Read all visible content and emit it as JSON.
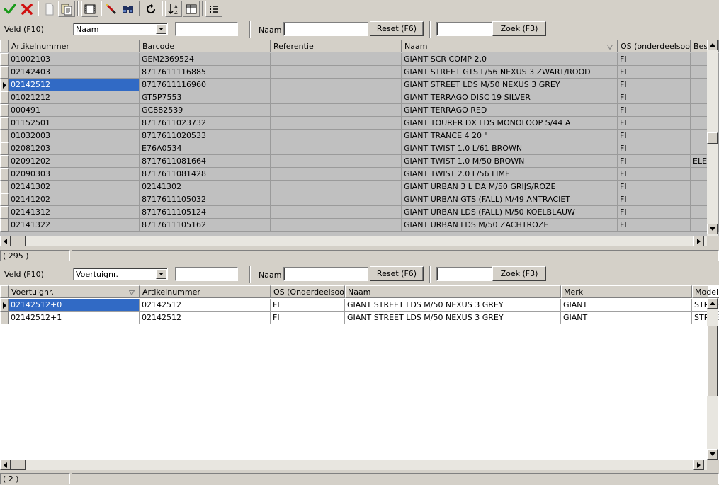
{
  "colors": {
    "selection": "#316ac5",
    "grid_bg": "#c0c0c0",
    "window_bg": "#d4d0c8"
  },
  "toolbar": {
    "buttons": [
      {
        "name": "ok-icon"
      },
      {
        "name": "cancel-icon"
      },
      {
        "name": "new-document-icon"
      },
      {
        "name": "paste-document-icon"
      },
      {
        "name": "film-icon"
      },
      {
        "name": "edit-pen-icon"
      },
      {
        "name": "binoculars-icon"
      },
      {
        "name": "refresh-icon"
      },
      {
        "name": "sort-icon"
      },
      {
        "name": "columns-icon"
      },
      {
        "name": "list-icon"
      }
    ]
  },
  "filter1": {
    "veld_label": "Veld (F10)",
    "veld_value": "Naam",
    "veld_input": "",
    "naam_label": "Naam",
    "naam_input": "",
    "reset_label": "Reset (F6)",
    "zoek_input": "",
    "zoek_label": "Zoek (F3)"
  },
  "grid1": {
    "columns": [
      "Artikelnummer",
      "Barcode",
      "Referentie",
      "Naam",
      "OS (onderdeelsoort)",
      "Beschrijving"
    ],
    "rows": [
      [
        "01002103",
        "GEM2369524",
        "",
        "GIANT SCR COMP 2.0",
        "FI",
        ""
      ],
      [
        "02142403",
        "8717611116885",
        "",
        "GIANT STREET GTS L/56 NEXUS 3 ZWART/ROOD",
        "FI",
        ""
      ],
      [
        "02142512",
        "8717611116960",
        "",
        "GIANT STREET LDS M/50 NEXUS 3 GREY",
        "FI",
        ""
      ],
      [
        "01021212",
        "GT5P7553",
        "",
        "GIANT TERRAGO DISC 19 SILVER",
        "FI",
        ""
      ],
      [
        "000491",
        "GC882539",
        "",
        "GIANT TERRAGO RED",
        "FI",
        ""
      ],
      [
        "01152501",
        "8717611023732",
        "",
        "GIANT TOURER DX LDS MONOLOOP S/44  A",
        "FI",
        ""
      ],
      [
        "01032003",
        "8717611020533",
        "",
        "GIANT TRANCE 4 20 \"",
        "FI",
        ""
      ],
      [
        "02081203",
        "E76A0534",
        "",
        "GIANT TWIST 1.0 L/61 BROWN",
        "FI",
        ""
      ],
      [
        "02091202",
        "8717611081664",
        "",
        "GIANT TWIST 1.0 M/50 BROWN",
        "FI",
        "ELECTRISCHE FIETS"
      ],
      [
        "02090303",
        "8717611081428",
        "",
        "GIANT TWIST 2.0 L/56 LIME",
        "FI",
        ""
      ],
      [
        "02141302",
        "02141302",
        "",
        "GIANT URBAN 3 L DA M/50 GRIJS/ROZE",
        "FI",
        ""
      ],
      [
        "02141202",
        "8717611105032",
        "",
        "GIANT URBAN GTS (FALL) M/49 ANTRACIET",
        "FI",
        ""
      ],
      [
        "02141312",
        "8717611105124",
        "",
        "GIANT URBAN LDS (FALL) M/50 KOELBLAUW",
        "FI",
        ""
      ],
      [
        "02141322",
        "8717611105162",
        "",
        "GIANT URBAN LDS M/50 ZACHTROZE",
        "FI",
        ""
      ]
    ],
    "selected_row": 2
  },
  "status1": {
    "count": "( 295 )",
    "extra": ""
  },
  "filter2": {
    "veld_label": "Veld (F10)",
    "veld_value": "Voertuignr.",
    "veld_input": "",
    "naam_label": "Naam",
    "naam_input": "",
    "reset_label": "Reset (F6)",
    "zoek_input": "",
    "zoek_label": "Zoek (F3)"
  },
  "grid2": {
    "columns": [
      "Voertuignr.",
      "Artikelnummer",
      "OS (Onderdeelsoort)",
      "Naam",
      "Merk",
      "Model"
    ],
    "rows": [
      [
        "02142512+0",
        "02142512",
        "FI",
        "GIANT STREET LDS M/50 NEXUS 3 GREY",
        "GIANT",
        "STREET"
      ],
      [
        "02142512+1",
        "02142512",
        "FI",
        "GIANT STREET LDS M/50 NEXUS 3 GREY",
        "GIANT",
        "STREET"
      ]
    ],
    "selected_row": 0
  },
  "status2": {
    "count": "( 2 )",
    "extra": ""
  }
}
